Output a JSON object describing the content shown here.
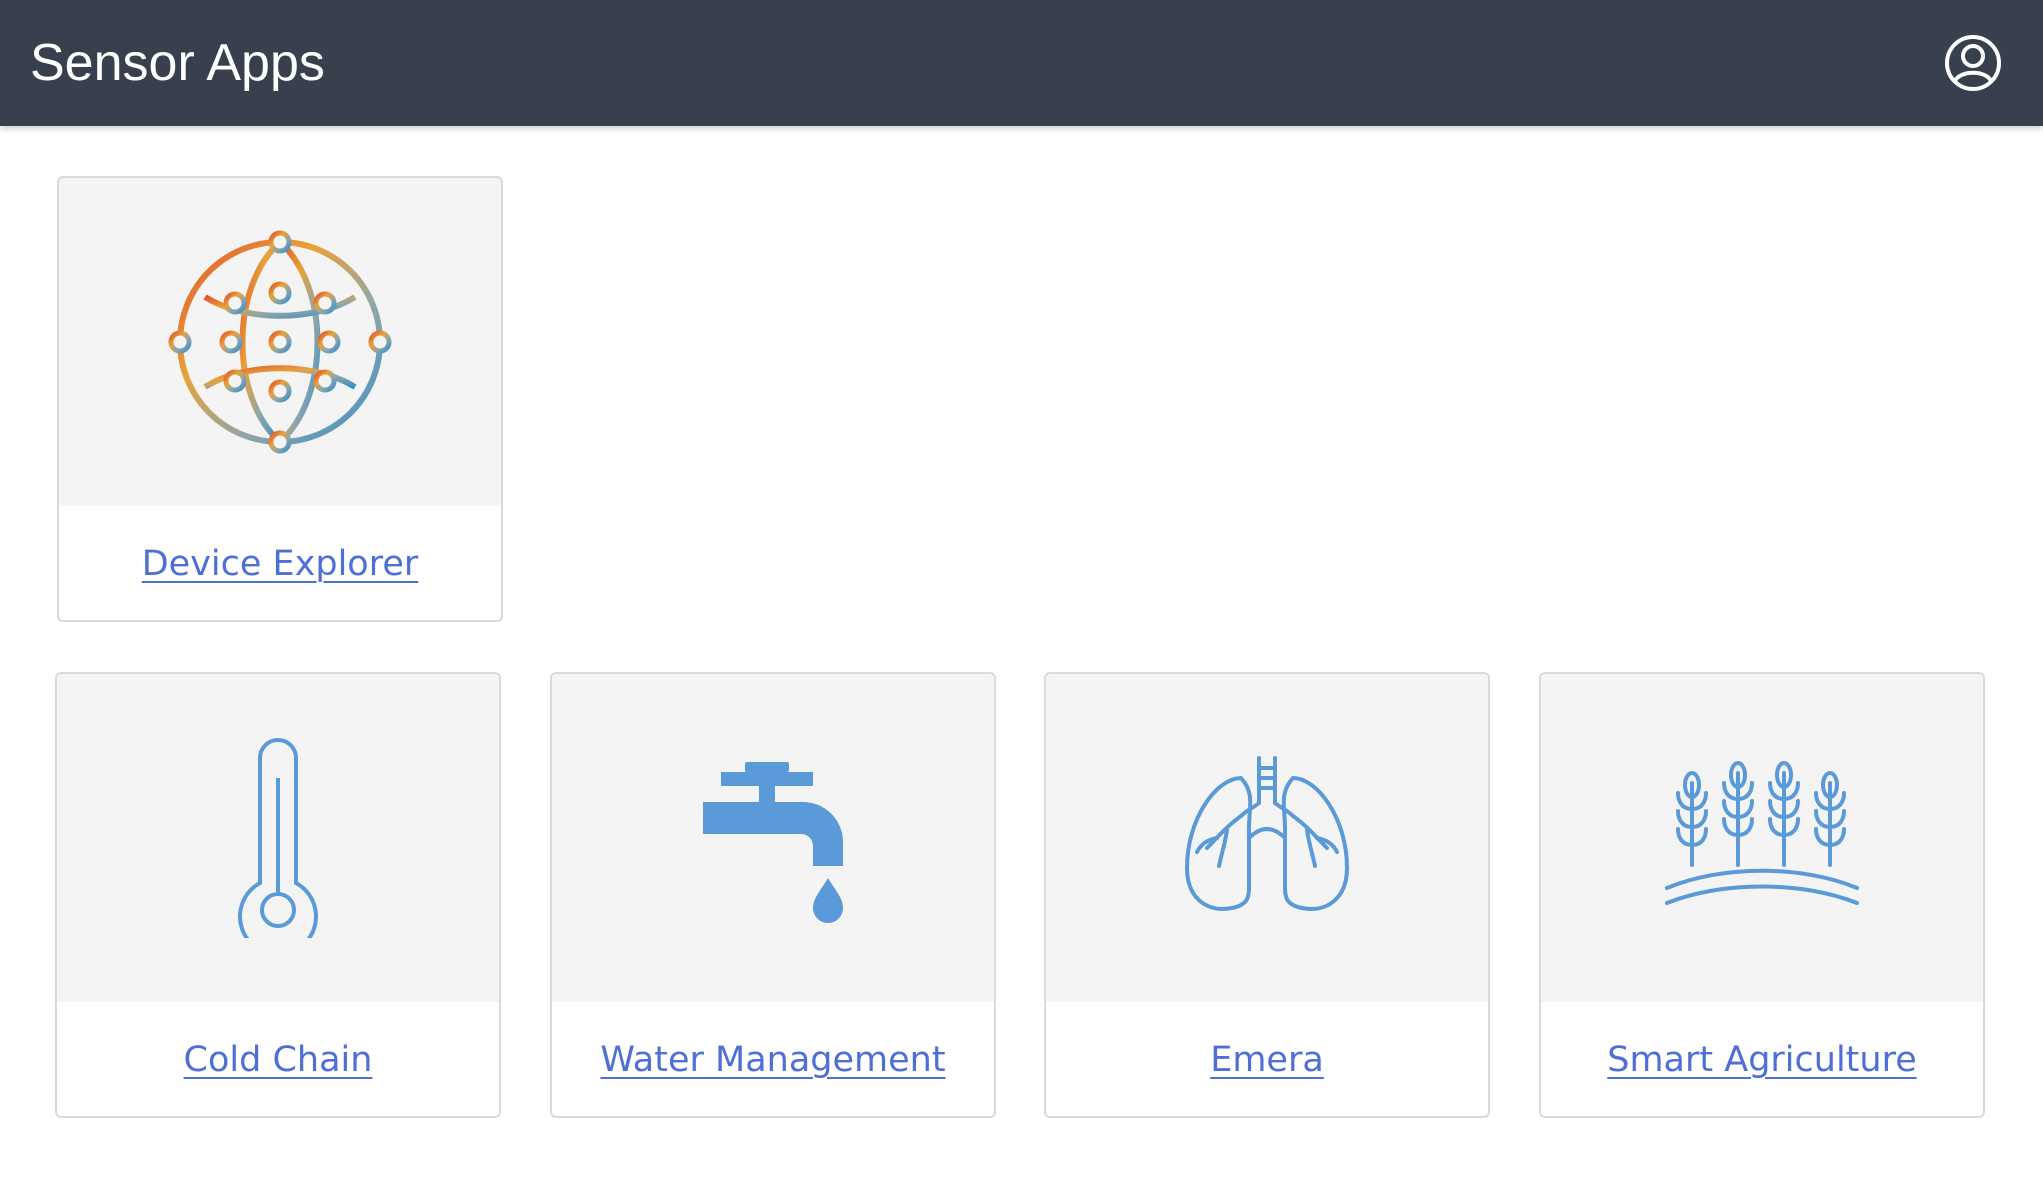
{
  "header": {
    "title": "Sensor Apps",
    "user_icon": "user-circle-icon",
    "background": "#37404c"
  },
  "apps": [
    {
      "label": "Device Explorer",
      "icon": "globe-network-icon"
    },
    {
      "label": "Cold Chain",
      "icon": "thermometer-icon"
    },
    {
      "label": "Water Management",
      "icon": "faucet-icon"
    },
    {
      "label": "Emera",
      "icon": "lungs-icon"
    },
    {
      "label": "Smart Agriculture",
      "icon": "wheat-icon"
    }
  ],
  "colors": {
    "link": "#4f6fd8",
    "icon_blue": "#5a9ad8",
    "card_bg": "#f4f4f4"
  }
}
